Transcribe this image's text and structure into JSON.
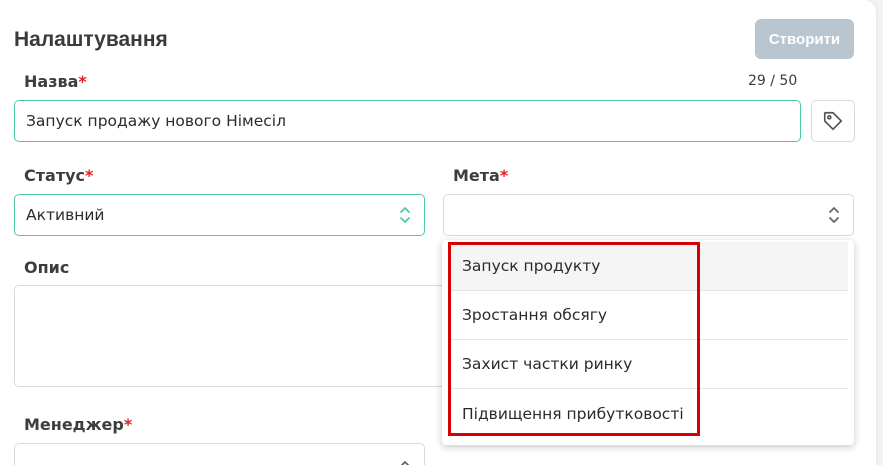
{
  "header": {
    "title": "Налаштування",
    "create_label": "Створити"
  },
  "name_field": {
    "label": "Назва",
    "required_mark": "*",
    "value": "Запуск продажу нового Німесіл",
    "counter": "29 / 50"
  },
  "status_field": {
    "label": "Статус",
    "required_mark": "*",
    "value": "Активний"
  },
  "goal_field": {
    "label": "Мета",
    "required_mark": "*",
    "value": ""
  },
  "description_field": {
    "label": "Опис",
    "value": ""
  },
  "manager_field": {
    "label": "Менеджер",
    "required_mark": "*",
    "value": ""
  },
  "goal_options": [
    {
      "label": "Запуск продукту"
    },
    {
      "label": "Зростання обсягу"
    },
    {
      "label": "Захист частки ринку"
    },
    {
      "label": "Підвищення прибутковості"
    }
  ],
  "colors": {
    "accent_border": "#4fc9a0",
    "required": "#e02020",
    "button_disabled": "#b9c6d0",
    "highlight": "#d80000"
  },
  "icons": {
    "tag": "tag-icon",
    "select_arrows": "chevron-up-down-icon"
  }
}
